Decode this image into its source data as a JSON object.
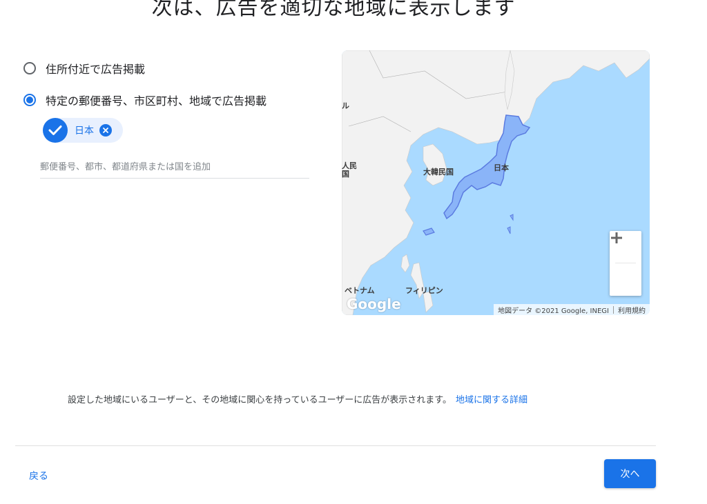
{
  "page": {
    "title": "次は、広告を適切な地域に表示します"
  },
  "location_options": [
    {
      "label": "住所付近で広告掲載",
      "selected": false
    },
    {
      "label": "特定の郵便番号、市区町村、地域で広告掲載",
      "selected": true
    }
  ],
  "selected_locations": [
    {
      "label": "日本"
    }
  ],
  "search": {
    "placeholder": "郵便番号、都市、都道府県または国を追加",
    "value": ""
  },
  "map": {
    "labels": {
      "korea": "大韓民国",
      "japan": "日本",
      "vietnam": "ベトナム",
      "philippines": "フィリピン",
      "china_partial": "人民\n国",
      "mongolia_partial": "ル"
    },
    "logo": "Google",
    "attribution": "地図データ ©2021 Google, INEGI",
    "terms": "利用規約",
    "zoom_in": "+",
    "zoom_out": "−",
    "colors": {
      "water": "#aadaff",
      "land": "#f2f2f2",
      "highlight": "#8ab4f8",
      "highlight_stroke": "#5b7be0"
    }
  },
  "info": {
    "text": "設定した地域にいるユーザーと、その地域に関心を持っているユーザーに広告が表示されます。",
    "link": "地域に関する詳細"
  },
  "footer": {
    "back_label": "戻る",
    "next_label": "次へ"
  },
  "colors": {
    "accent": "#1a73e8"
  }
}
